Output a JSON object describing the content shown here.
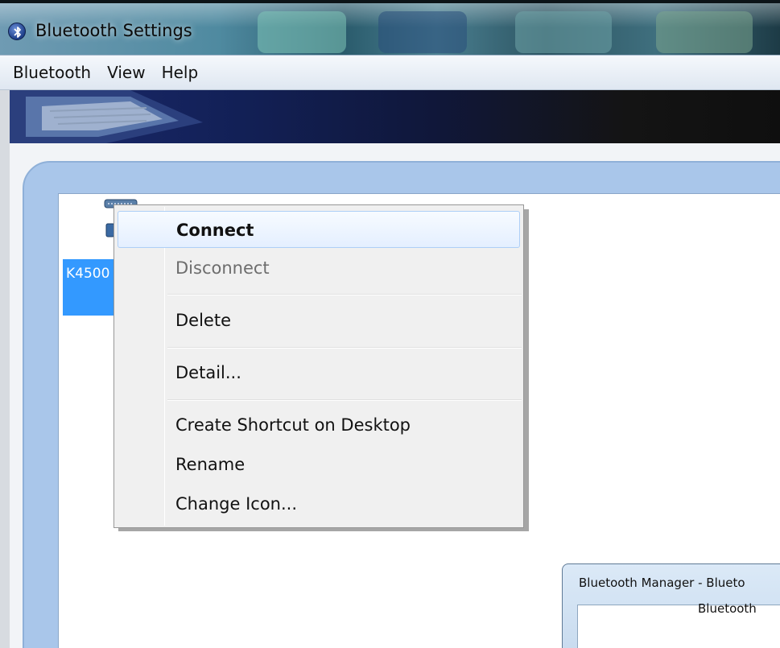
{
  "window": {
    "title": "Bluetooth Settings",
    "icon": "bluetooth-icon"
  },
  "menubar": {
    "items": [
      "Bluetooth",
      "View",
      "Help"
    ]
  },
  "device": {
    "label": "K4500",
    "icon": "keyboard-icon",
    "selected": true
  },
  "context_menu": {
    "items": [
      {
        "label": "Connect",
        "state": "highlighted"
      },
      {
        "label": "Disconnect",
        "state": "disabled"
      },
      {
        "label": "Delete",
        "state": "normal"
      },
      {
        "label": "Detail...",
        "state": "normal"
      },
      {
        "label": "Create Shortcut on Desktop",
        "state": "normal"
      },
      {
        "label": "Rename",
        "state": "normal"
      },
      {
        "label": "Change Icon...",
        "state": "normal"
      }
    ]
  },
  "sub_window": {
    "title": "Bluetooth Manager - Blueto",
    "body_text": "Bluetooth"
  },
  "colors": {
    "selection": "#3399ff",
    "panel_blue": "#a9c6ea",
    "menu_highlight": "#e4efff"
  }
}
